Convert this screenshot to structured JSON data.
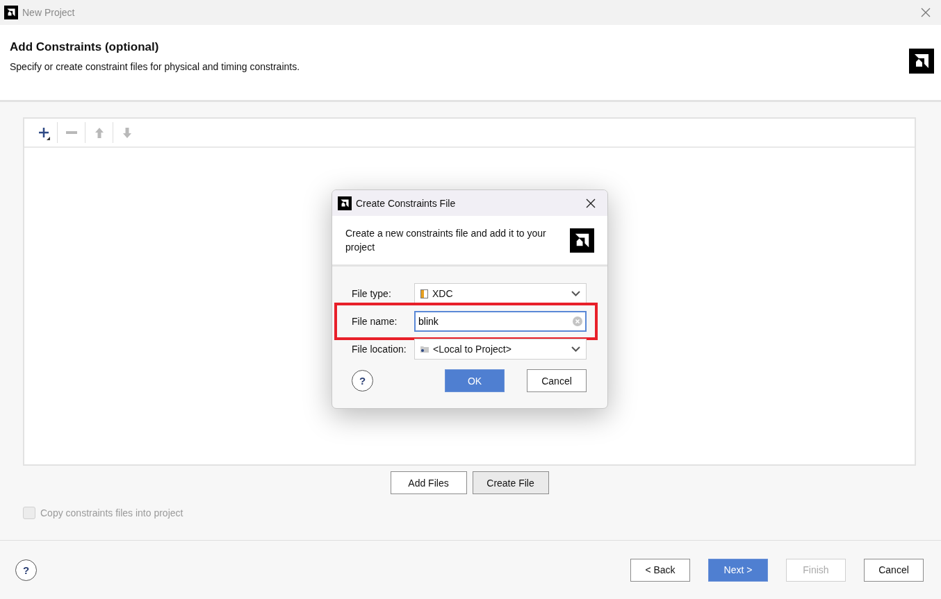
{
  "window": {
    "title": "New Project"
  },
  "header": {
    "title": "Add Constraints (optional)",
    "subtitle": "Specify or create constraint files for physical and timing constraints."
  },
  "toolbar": [
    {
      "kind": "add",
      "disabled": false
    },
    {
      "kind": "remove",
      "disabled": true
    },
    {
      "kind": "up",
      "disabled": true
    },
    {
      "kind": "down",
      "disabled": true
    }
  ],
  "file_buttons": [
    {
      "label": "Add Files",
      "kind": "default"
    },
    {
      "label": "Create File",
      "kind": "pressed"
    }
  ],
  "copy_option": {
    "label": "Copy constraints files into project",
    "checked": false,
    "disabled": true
  },
  "footer_help": "?",
  "footer_buttons": [
    {
      "label": "< Back",
      "kind": "default",
      "disabled": false
    },
    {
      "label": "Next >",
      "kind": "primary",
      "disabled": false
    },
    {
      "label": "Finish",
      "kind": "default",
      "disabled": true
    },
    {
      "label": "Cancel",
      "kind": "default",
      "disabled": false
    }
  ],
  "dialog": {
    "title": "Create Constraints File",
    "description": "Create a new constraints file and add it to your project",
    "fields": [
      {
        "label": "File type:",
        "kind": "type-select",
        "value": "XDC",
        "highlighted": false
      },
      {
        "label": "File name:",
        "kind": "text",
        "value": "blink",
        "highlighted": true
      },
      {
        "label": "File location:",
        "kind": "location-select",
        "value": "<Local to Project>",
        "highlighted": false
      }
    ],
    "help": "?",
    "buttons": [
      {
        "label": "OK",
        "kind": "primary"
      },
      {
        "label": "Cancel",
        "kind": "default"
      }
    ]
  }
}
